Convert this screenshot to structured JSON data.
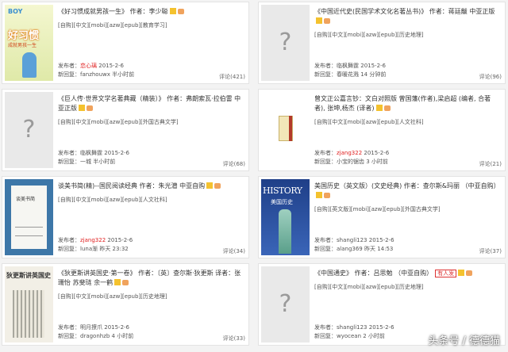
{
  "books": [
    {
      "title": "《好习惯成就男孩一生》 作者：李少聪",
      "tags": "[自购][中文][mobi][azw][epub][教育学习]",
      "poster_label": "发布者：",
      "poster": "恋心璃",
      "poster_red": true,
      "date": "2015-2-6",
      "reply_label": "新回复：",
      "reply": "fanzhouwx 半小时前",
      "comment": "评论(421)",
      "cover_text": [
        "BOY",
        "好习惯",
        "成就男孩一生"
      ]
    },
    {
      "title": "《中国近代史(民国学术文化名著丛书)》 作者：蒋廷黻 中亚正版",
      "tags": "[自购][中文][mobi][azw][epub][历史地理]",
      "poster_label": "发布者：",
      "poster": "临枫舞霆",
      "poster_red": false,
      "date": "2015-2-6",
      "reply_label": "新回复：",
      "reply": "春暖花溅 14 分钟前",
      "comment": "评论(96)"
    },
    {
      "title": "《巨人传·世界文学名著典藏（精装）》 作者：弗朗索瓦·拉伯雷 中亚正版",
      "tags": "[自购][中文][mobi][azw][epub][外国古典文学]",
      "poster_label": "发布者：",
      "poster": "临枫舞霆",
      "poster_red": false,
      "date": "2015-2-6",
      "reply_label": "新回复：",
      "reply": "一城 半小时前",
      "comment": "评论(68)"
    },
    {
      "title": "曾文正公嘉言钞：文白对照版 曾国藩(作者),梁启超 (编者, 合著者), 张坤,杨杰 (译者)",
      "tags": "[自购][中文][mobi][azw][epub][人文社科]",
      "poster_label": "发布者：",
      "poster": "zjang322",
      "poster_red": true,
      "date": "2015-2-6",
      "reply_label": "新回复：",
      "reply": "小宝的锯齿 3 小时前",
      "comment": "评论(21)"
    },
    {
      "title": "谈美书简(精)--国民阅读经典 作者：朱光潜 中亚自购",
      "tags": "[自购][中文][mobi][azw][epub][人文社科]",
      "poster_label": "发布者：",
      "poster": "zjang322",
      "poster_red": true,
      "date": "2015-2-6",
      "reply_label": "新回复：",
      "reply": "luna渐 昨天 23:32",
      "comment": "评论(34)",
      "cover_text": [
        "谈美书简"
      ]
    },
    {
      "title": "美国历史（英文版）(文史经典) 作者：查尔斯&玛丽 （中亚自购）",
      "tags": "[自购][英文版][mobi][azw][epub][外国古典文学]",
      "poster_label": "发布者：",
      "poster": "shangli123",
      "poster_red": false,
      "date": "2015-2-6",
      "reply_label": "新回复：",
      "reply": "alang369 昨天 14:53",
      "comment": "评论(37)",
      "cover_text": [
        "HISTORY",
        "美国历史"
      ]
    },
    {
      "title": "《狄更斯讲英国史·第一卷》 作者：〔英〕查尔斯·狄更斯 译者：张珊怡 苏斐琏 余一鹤",
      "tags": "[自购][中文][mobi][azw][epub][历史地理]",
      "poster_label": "发布者：",
      "poster": "明月撩爪",
      "poster_red": false,
      "date": "2015-2-6",
      "reply_label": "新回复：",
      "reply": "dragonhzb 4 小时前",
      "comment": "评论(33)",
      "cover_text": [
        "狄更斯讲英国史"
      ]
    },
    {
      "title": "《中国通史》 作者：吕思勉 （中亚自购）",
      "tags": "[自购][中文][mobi][azw][epub][历史地理]",
      "poster_label": "发布者：",
      "poster": "shangli123",
      "poster_red": false,
      "date": "2015-2-6",
      "reply_label": "新回复：",
      "reply": "wyocean 2 小时前",
      "comment": "",
      "badge": "有人发"
    }
  ],
  "watermark": "头条号 / 德德猫"
}
